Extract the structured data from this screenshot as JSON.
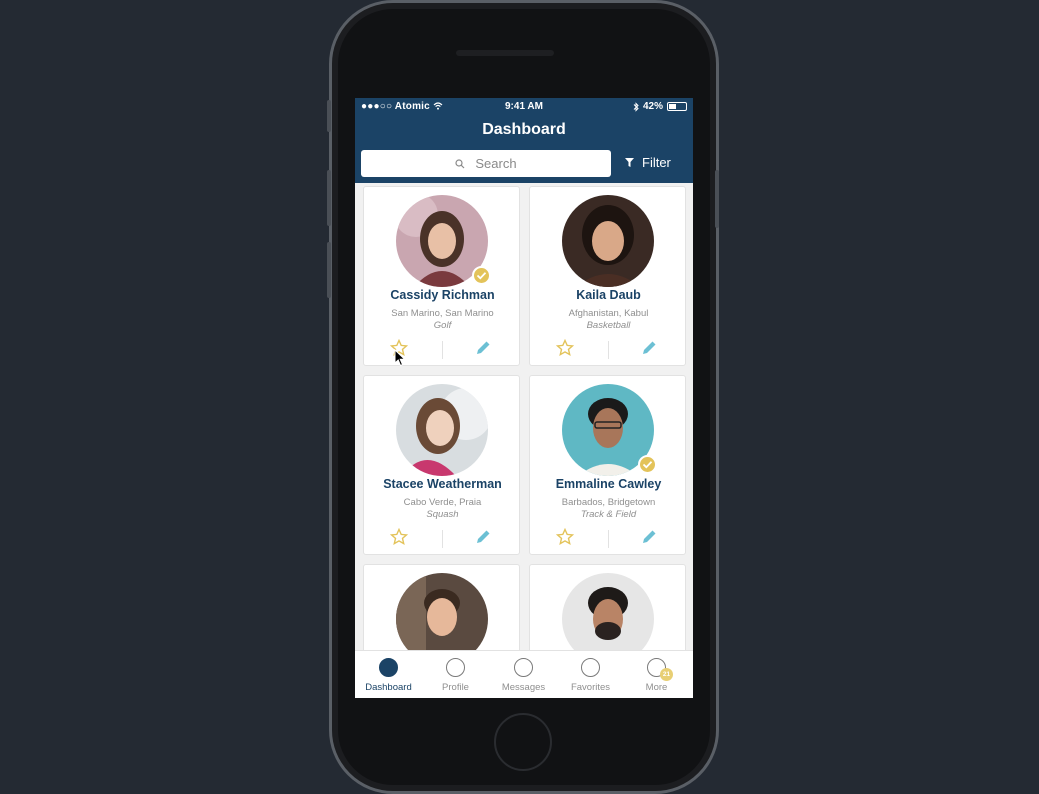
{
  "status_bar": {
    "carrier": "●●●○○ Atomic",
    "time": "9:41 AM",
    "battery": "42%"
  },
  "header": {
    "title": "Dashboard",
    "search_placeholder": "Search",
    "filter_label": "Filter"
  },
  "profiles": [
    {
      "name": "Cassidy Richman",
      "location": "San Marino, San Marino",
      "sport": "Golf",
      "verified": true
    },
    {
      "name": "Kaila Daub",
      "location": "Afghanistan, Kabul",
      "sport": "Basketball",
      "verified": false
    },
    {
      "name": "Stacee Weatherman",
      "location": "Cabo Verde, Praia",
      "sport": "Squash",
      "verified": false
    },
    {
      "name": "Emmaline Cawley",
      "location": "Barbados, Bridgetown",
      "sport": "Track & Field",
      "verified": true
    },
    {
      "name": "",
      "location": "",
      "sport": "",
      "verified": false
    },
    {
      "name": "",
      "location": "",
      "sport": "",
      "verified": false
    }
  ],
  "tabbar": {
    "tabs": [
      {
        "label": "Dashboard",
        "active": true
      },
      {
        "label": "Profile",
        "active": false
      },
      {
        "label": "Messages",
        "active": false
      },
      {
        "label": "Favorites",
        "active": false
      },
      {
        "label": "More",
        "active": false
      }
    ],
    "more_badge": "21"
  },
  "colors": {
    "brand": "#1b4366",
    "accent_gold": "#e3c35a",
    "edit_blue": "#6cc0d4",
    "background": "#242a33"
  },
  "icons": [
    "search-icon",
    "filter-icon",
    "star-icon",
    "pencil-icon",
    "check-badge-icon",
    "wifi-icon",
    "bluetooth-icon",
    "battery-icon"
  ]
}
